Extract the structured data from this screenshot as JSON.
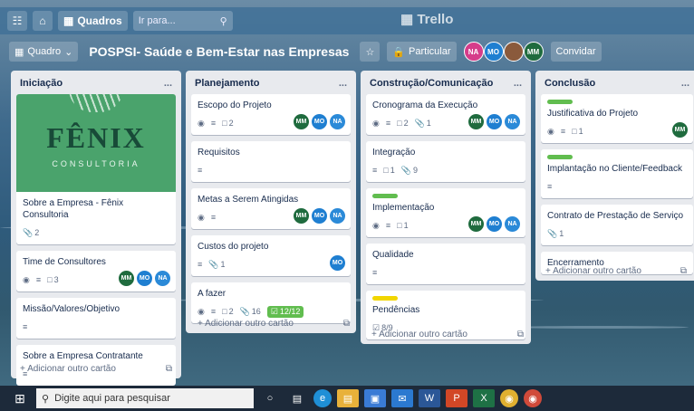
{
  "app": {
    "logo": "Trello"
  },
  "topbar": {
    "apps_icon": "grid-icon",
    "home_icon": "home-icon",
    "boards_label": "Quadros",
    "search_placeholder": "Ir para...",
    "search_icon": "search-icon"
  },
  "boardbar": {
    "board_switch_label": "Quadro",
    "title": "POSPSI- Saúde e Bem-Estar nas Empresas",
    "visibility_label": "Particular",
    "members": [
      "NA",
      "MO",
      "",
      "MM"
    ],
    "invite_label": "Convidar"
  },
  "lists": [
    {
      "title": "Iniciação",
      "menu": "...",
      "cover": {
        "title": "FÊNIX",
        "subtitle": "CONSULTORIA"
      },
      "cards": [
        {
          "title": "Sobre a Empresa - Fênix Consultoria",
          "attachments": "2"
        },
        {
          "title": "Time de Consultores",
          "comments": "3",
          "members": [
            "MM",
            "MO",
            "NA"
          ]
        },
        {
          "title": "Missão/Valores/Objetivo"
        },
        {
          "title": "Sobre a Empresa Contratante"
        }
      ],
      "add_card": "+ Adicionar outro cartão"
    },
    {
      "title": "Planejamento",
      "menu": "...",
      "cards": [
        {
          "title": "Escopo do Projeto",
          "comments": "2",
          "members": [
            "MM",
            "MO",
            "NA"
          ]
        },
        {
          "title": "Requisitos"
        },
        {
          "title": "Metas a Serem Atingidas",
          "members": [
            "MM",
            "MO",
            "NA"
          ]
        },
        {
          "title": "Custos do projeto",
          "attachments": "1",
          "members": [
            "MO"
          ]
        },
        {
          "title": "A fazer",
          "comments": "2",
          "attachments": "16",
          "checklist": "12/12"
        }
      ],
      "add_card": "+ Adicionar outro cartão"
    },
    {
      "title": "Construção/Comunicação",
      "menu": "...",
      "cards": [
        {
          "title": "Cronograma da Execução",
          "comments": "2",
          "attachments": "1",
          "members": [
            "MM",
            "MO",
            "NA"
          ]
        },
        {
          "title": "Integração",
          "comments": "1",
          "attachments": "9"
        },
        {
          "title": "Implementação",
          "comments": "1",
          "members": [
            "MM",
            "MO",
            "NA"
          ],
          "label_color": "#61bd4f"
        },
        {
          "title": "Qualidade"
        },
        {
          "title": "Pendências",
          "checklist": "8/9",
          "label_color": "#f2d600"
        }
      ],
      "add_card": "+ Adicionar outro cartão"
    },
    {
      "title": "Conclusão",
      "menu": "...",
      "cards": [
        {
          "title": "Justificativa do Projeto",
          "comments": "1",
          "members": [
            "MM"
          ],
          "label_color": "#61bd4f"
        },
        {
          "title": "Implantação no Cliente/Feedback",
          "label_color": "#61bd4f"
        },
        {
          "title": "Contrato de Prestação de Serviço",
          "attachments": "1"
        },
        {
          "title": "Encerramento"
        }
      ],
      "add_card": "+ Adicionar outro cartão"
    }
  ],
  "taskbar": {
    "search_placeholder": "Digite aqui para pesquisar"
  },
  "colors": {
    "label_green": "#61bd4f",
    "label_yellow": "#f2d600",
    "checklist_done": "#61bd4f",
    "avatar_mm": "#1f6b3e",
    "avatar_mo": "#1f7fd1",
    "avatar_na": "#2b8ad8"
  }
}
